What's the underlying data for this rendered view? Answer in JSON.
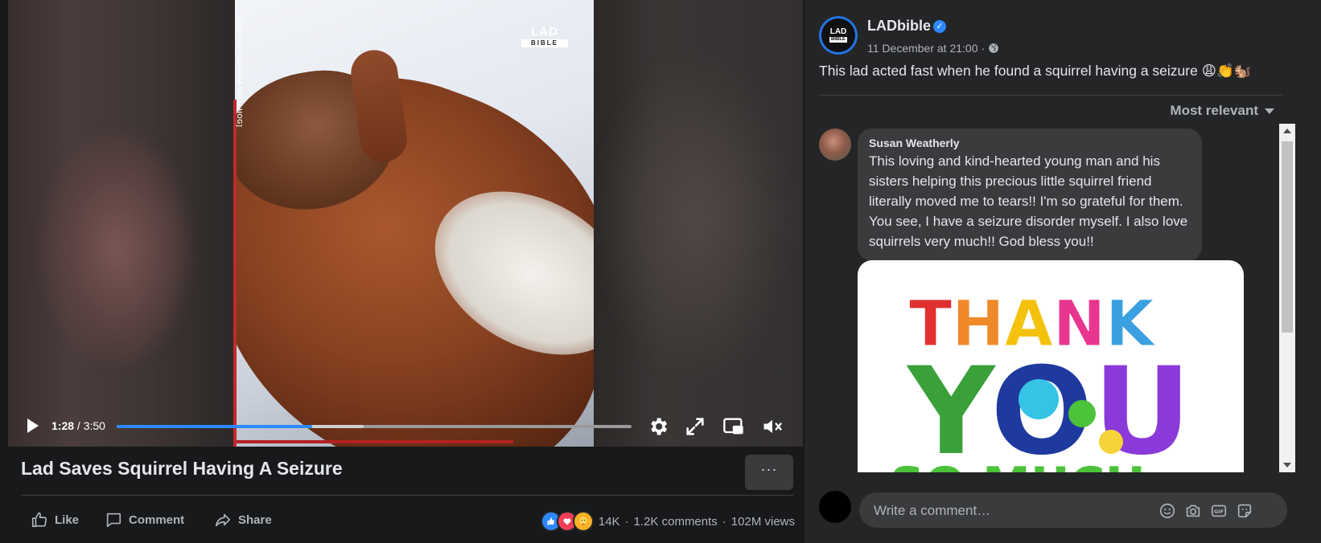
{
  "video": {
    "watermark": "LAD",
    "watermark_sub": "BIBLE",
    "credit": "[LEO HURTADO VIA VIRALHOG]",
    "current_time": "1:28",
    "duration_text": " / 3:50",
    "played_fraction": 0.38,
    "buffered_fraction": 0.48,
    "title": "Lad Saves Squirrel Having A Seizure",
    "more_label": "···"
  },
  "actions": {
    "like": "Like",
    "comment": "Comment",
    "share": "Share"
  },
  "stats": {
    "reactions": "14K",
    "comments": "1.2K comments",
    "views": "102M views",
    "sep1": "·",
    "sep2": "·"
  },
  "post": {
    "page_name": "LADbible",
    "avatar_text": "LAD",
    "avatar_sub": "BIBLE",
    "timestamp": "11 December at 21:00",
    "meta_sep": "·",
    "text": "This lad acted fast when he found a squirrel having a seizure 😩👏🐿️",
    "sort_label": "Most relevant"
  },
  "comments": [
    {
      "author": "Susan Weatherly",
      "text": "This loving and kind-hearted young man and his sisters helping this precious little squirrel friend literally moved me to tears!! I'm so grateful for them. You see, I have a seizure disorder myself. I also love squirrels very much!! God bless you!!",
      "image_words": [
        "THANK",
        "YOU",
        "SO MUCH"
      ]
    }
  ],
  "composer": {
    "placeholder": "Write a comment…"
  },
  "colors": {
    "accent": "#2d88ff",
    "background": "#18191a",
    "panel": "#242526",
    "bubble": "#3a3b3c"
  }
}
